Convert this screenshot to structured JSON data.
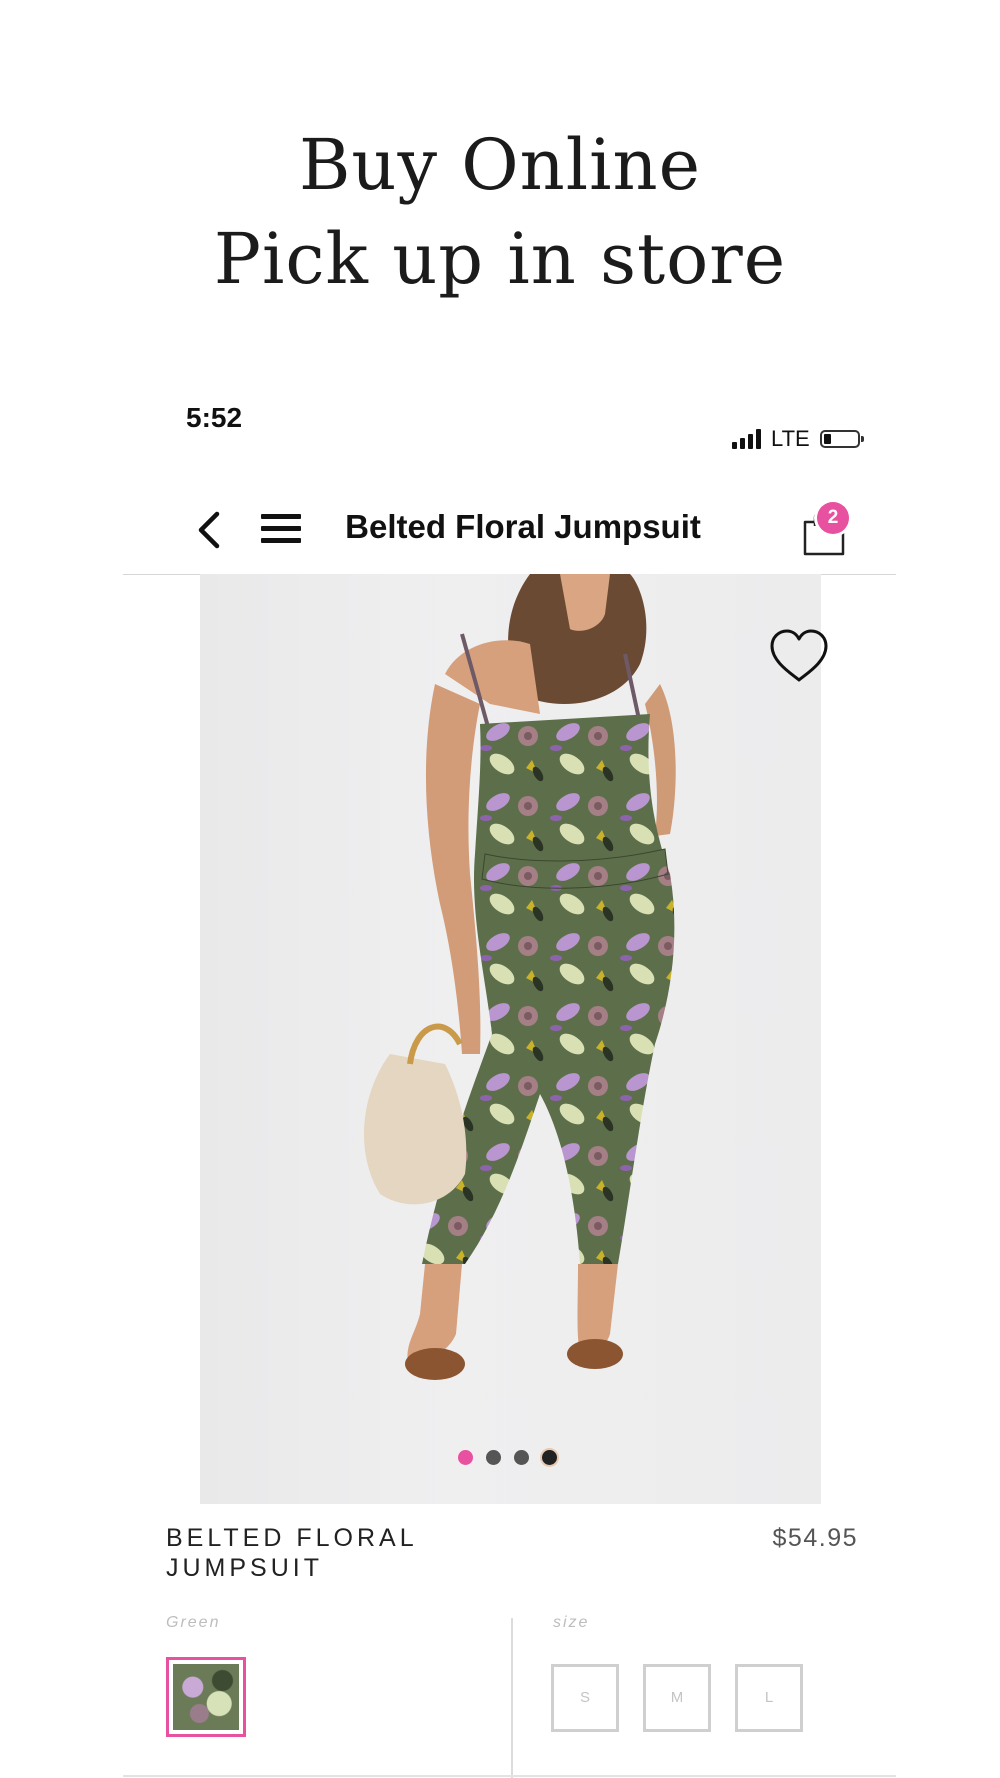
{
  "promo": {
    "line1": "Buy Online",
    "line2": "Pick up in store"
  },
  "status_bar": {
    "time": "5:52",
    "network": "LTE",
    "signal_bars": 4,
    "battery_level": 0.2
  },
  "navbar": {
    "title": "Belted Floral Jumpsuit",
    "cart_count": "2",
    "icons": [
      "chevron-left-icon",
      "hamburger-menu-icon",
      "shopping-bag-icon"
    ]
  },
  "product": {
    "name": "BELTED FLORAL\nJUMPSUIT",
    "price": "$54.95",
    "image_count": 4,
    "active_image": 1,
    "favorite_icon": "heart-outline-icon",
    "color_label": "Green",
    "size_label": "size",
    "sizes": [
      "S",
      "M",
      "L"
    ]
  },
  "colors": {
    "accent": "#e8519f",
    "text": "#111111",
    "muted": "#bdbdbd"
  }
}
